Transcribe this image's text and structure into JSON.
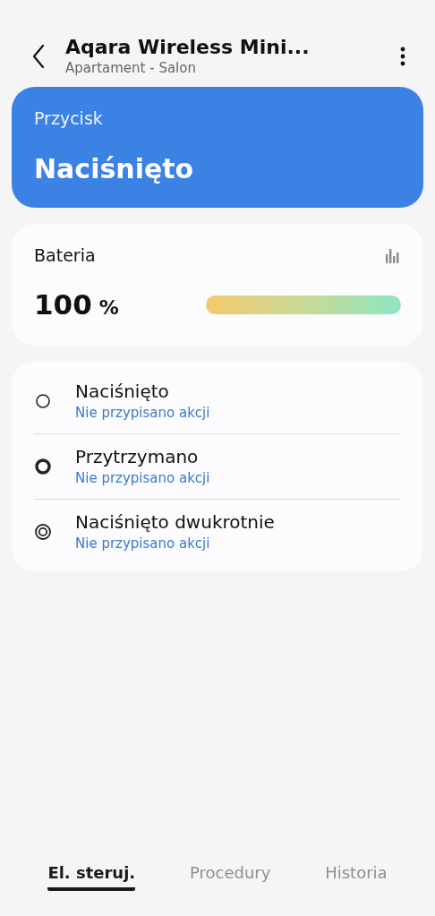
{
  "header": {
    "title": "Aqara Wireless Mini...",
    "subtitle": "Apartament - Salon"
  },
  "status_card": {
    "label": "Przycisk",
    "value": "Naciśnięto"
  },
  "battery": {
    "label": "Bateria",
    "value": "100",
    "unit": "%",
    "level": 1
  },
  "actions": [
    {
      "kind": "press",
      "name": "Naciśnięto",
      "action": "Nie przypisano akcji"
    },
    {
      "kind": "hold",
      "name": "Przytrzymano",
      "action": "Nie przypisano akcji"
    },
    {
      "kind": "double",
      "name": "Naciśnięto dwukrotnie",
      "action": "Nie przypisano akcji"
    }
  ],
  "tabs": [
    {
      "label": "El. steruj.",
      "selected": true
    },
    {
      "label": "Procedury",
      "selected": false
    },
    {
      "label": "Historia",
      "selected": false
    }
  ]
}
